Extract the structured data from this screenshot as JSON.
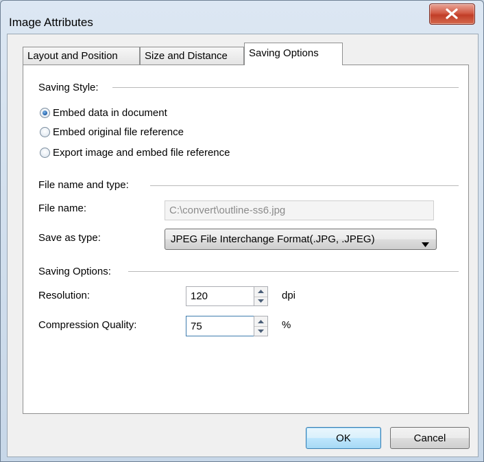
{
  "window": {
    "title": "Image Attributes"
  },
  "tabs": [
    {
      "label": "Layout and Position"
    },
    {
      "label": "Size and Distance"
    },
    {
      "label": "Saving Options"
    }
  ],
  "saving_style": {
    "heading": "Saving Style:",
    "options": [
      {
        "label": "Embed data in document",
        "checked": true
      },
      {
        "label": "Embed original file reference",
        "checked": false
      },
      {
        "label": "Export image and embed file reference",
        "checked": false
      }
    ]
  },
  "file": {
    "heading": "File name and type:",
    "name_label": "File name:",
    "name_value": "C:\\convert\\outline-ss6.jpg",
    "type_label": "Save as type:",
    "type_value": "JPEG File Interchange Format(.JPG, .JPEG)"
  },
  "saving_options": {
    "heading": "Saving Options:",
    "resolution_label": "Resolution:",
    "resolution_value": "120",
    "resolution_unit": "dpi",
    "compression_label": "Compression Quality:",
    "compression_value": "75",
    "compression_unit": "%"
  },
  "buttons": {
    "ok": "OK",
    "cancel": "Cancel"
  },
  "icons": {
    "close": "close-icon",
    "dropdown": "chevron-down-icon",
    "spin_up": "spin-up-icon",
    "spin_down": "spin-down-icon"
  }
}
